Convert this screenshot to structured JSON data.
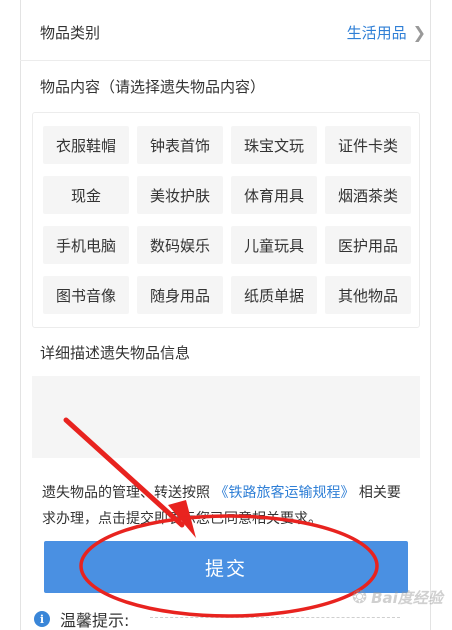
{
  "category": {
    "label": "物品类别",
    "value": "生活用品"
  },
  "content_section": {
    "title": "物品内容（请选择遗失物品内容）",
    "items": [
      "衣服鞋帽",
      "钟表首饰",
      "珠宝文玩",
      "证件卡类",
      "现金",
      "美妆护肤",
      "体育用具",
      "烟酒茶类",
      "手机电脑",
      "数码娱乐",
      "儿童玩具",
      "医护用品",
      "图书音像",
      "随身用品",
      "纸质单据",
      "其他物品"
    ]
  },
  "detail_section": {
    "title": "详细描述遗失物品信息",
    "value": ""
  },
  "notice": {
    "part1": "遗失物品的管理、转送按照",
    "link": "《铁路旅客运输规程》",
    "part2": "相关要求办理，点击提交即表示您已同意相关要求。"
  },
  "submit_label": "提交",
  "tip": {
    "icon": "info-icon",
    "label": "温馨提示:"
  },
  "watermark": {
    "text": "Bai度经验"
  },
  "colors": {
    "accent": "#2f7fd6",
    "button": "#4a90e2",
    "annotation": "#e8231f"
  }
}
